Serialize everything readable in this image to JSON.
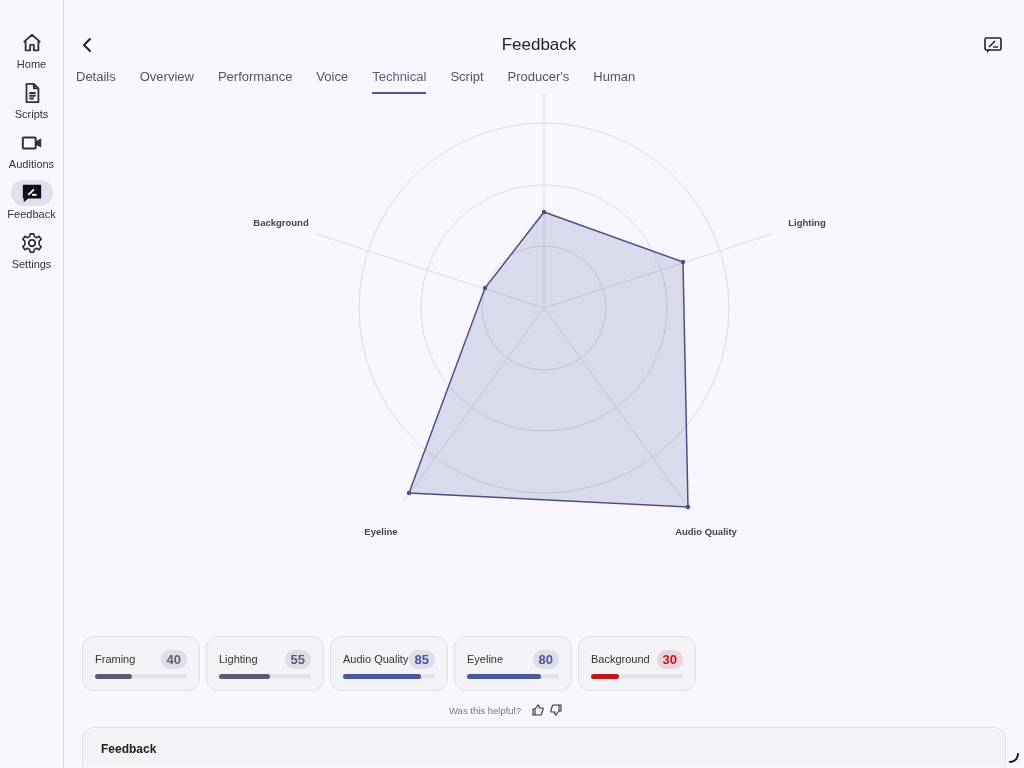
{
  "sidebar": {
    "items": [
      {
        "label": "Home",
        "selected": false
      },
      {
        "label": "Scripts",
        "selected": false
      },
      {
        "label": "Auditions",
        "selected": false
      },
      {
        "label": "Feedback",
        "selected": true
      },
      {
        "label": "Settings",
        "selected": false
      }
    ]
  },
  "header": {
    "title": "Feedback"
  },
  "tabs": [
    {
      "label": "Details",
      "selected": false
    },
    {
      "label": "Overview",
      "selected": false
    },
    {
      "label": "Performance",
      "selected": false
    },
    {
      "label": "Voice",
      "selected": false
    },
    {
      "label": "Technical",
      "selected": true
    },
    {
      "label": "Script",
      "selected": false
    },
    {
      "label": "Producer's",
      "selected": false
    },
    {
      "label": "Human",
      "selected": false
    }
  ],
  "radar": {
    "axis_labels": [
      "Background",
      "Lighting",
      "Eyeline",
      "Audio Quality"
    ]
  },
  "scores": [
    {
      "label": "Framing",
      "value": "40",
      "level": 0.4,
      "color": "#5a5e78"
    },
    {
      "label": "Lighting",
      "value": "55",
      "level": 0.55,
      "color": "#5a5e78"
    },
    {
      "label": "Audio Quality",
      "value": "85",
      "level": 0.85,
      "color": "#4a5899"
    },
    {
      "label": "Eyeline",
      "value": "80",
      "level": 0.8,
      "color": "#4a5899"
    },
    {
      "label": "Background",
      "value": "30",
      "level": 0.3,
      "color": "#c0161b"
    }
  ],
  "helpful": {
    "question": "Was this helpful?"
  },
  "feedback_card": {
    "title": "Feedback"
  }
}
